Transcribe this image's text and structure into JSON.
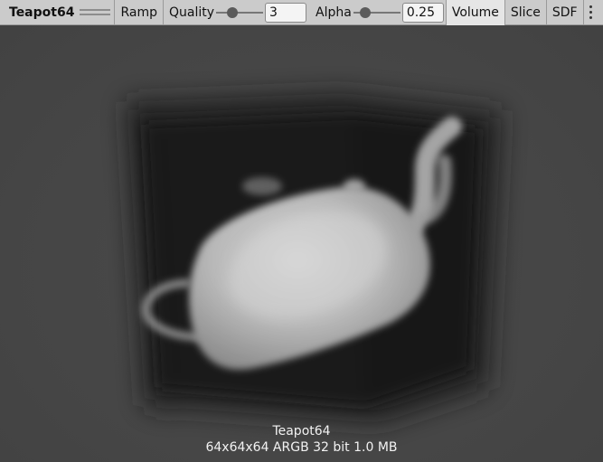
{
  "toolbar": {
    "asset_name": "Teapot64",
    "ramp_label": "Ramp",
    "quality": {
      "label": "Quality",
      "value": "3",
      "slider_fraction": 0.35
    },
    "alpha": {
      "label": "Alpha",
      "value": "0.25",
      "slider_fraction": 0.25
    },
    "modes": [
      "Volume",
      "Slice",
      "SDF"
    ],
    "active_mode": "Volume"
  },
  "preview": {
    "name": "Teapot64",
    "info": "64x64x64 ARGB 32 bit 1.0 MB"
  },
  "colors": {
    "toolbar_bg": "#cbcbcb",
    "viewport_bg": "#454545",
    "caption_text": "#f2f2f2"
  }
}
